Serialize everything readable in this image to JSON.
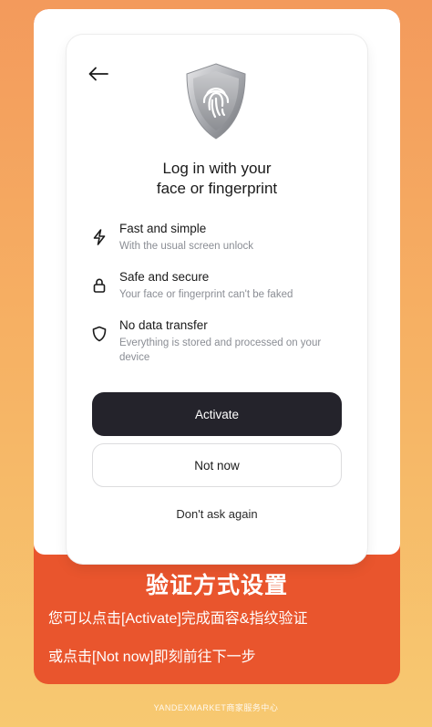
{
  "screen": {
    "title": "Log in with your\nface or fingerprint",
    "back_icon": "arrow-left-icon",
    "shield_icon": "fingerprint-shield-icon",
    "features": [
      {
        "icon": "lightning-icon",
        "title": "Fast and simple",
        "description": "With the usual screen unlock"
      },
      {
        "icon": "lock-icon",
        "title": "Safe and secure",
        "description": "Your face or fingerprint can't be faked"
      },
      {
        "icon": "shield-icon",
        "title": "No data transfer",
        "description": "Everything is stored and processed on your device"
      }
    ],
    "activate_label": "Activate",
    "not_now_label": "Not now",
    "dont_ask_label": "Don't ask again"
  },
  "caption": {
    "heading": "验证方式设置",
    "line1": "您可以点击[Activate]完成面容&指纹验证",
    "line2": "或点击[Not now]即刻前往下一步"
  },
  "footer": "YANDEXMARKET商家服务中心",
  "colors": {
    "primary_button": "#24232b",
    "caption_background": "#e9552d",
    "page_gradient_top": "#f39a5c",
    "page_gradient_bottom": "#f7c971"
  }
}
